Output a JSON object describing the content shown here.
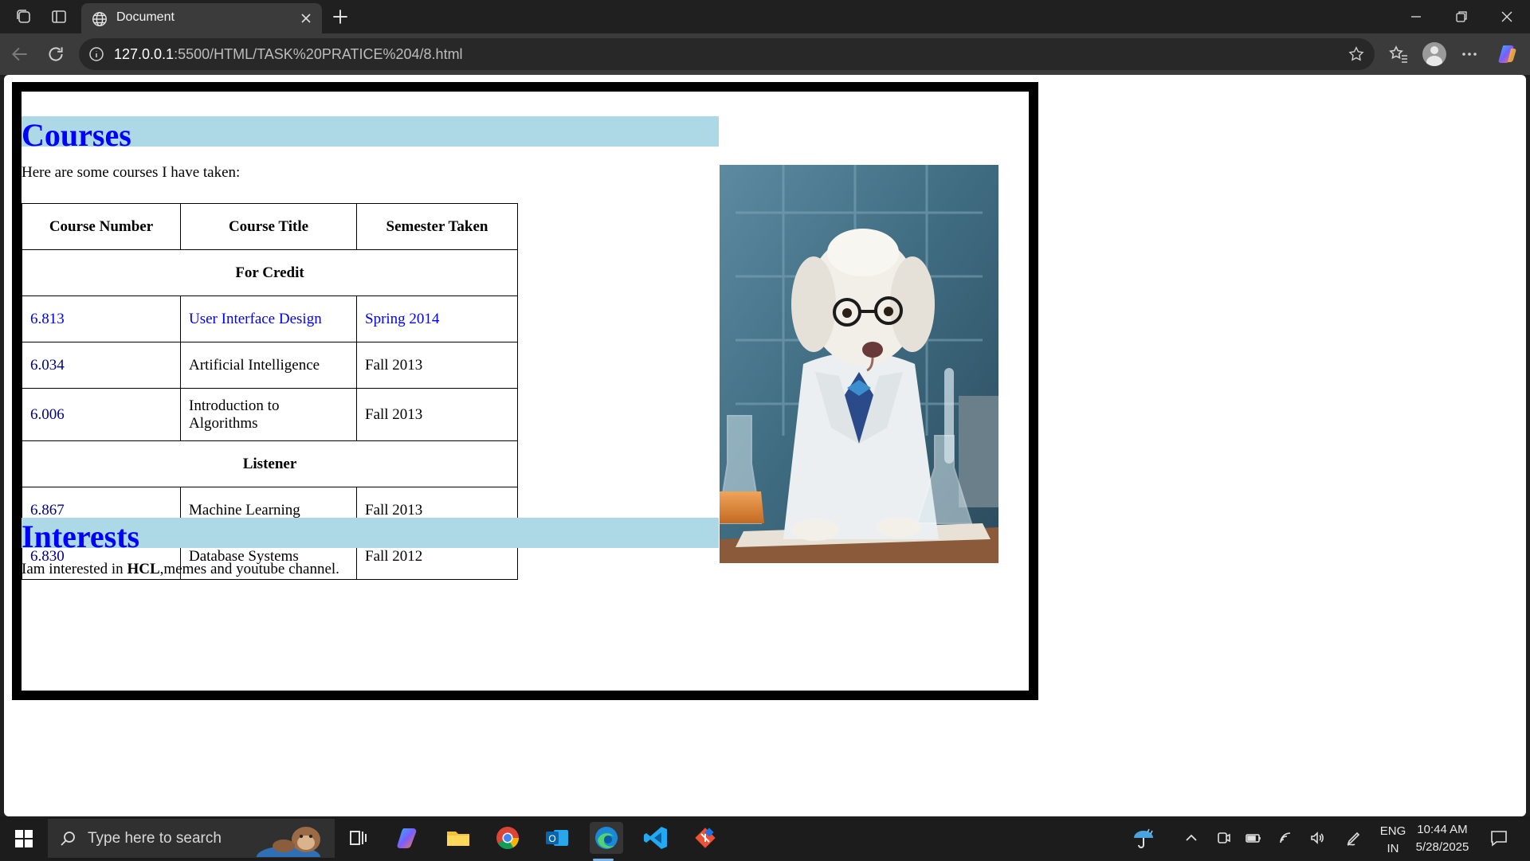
{
  "browser": {
    "tab_title": "Document",
    "url_host": "127.0.0.1",
    "url_rest": ":5500/HTML/TASK%20PRATICE%204/8.html"
  },
  "page": {
    "courses_heading": "Courses",
    "intro": "Here are some courses I have taken:",
    "table": {
      "headers": [
        "Course Number",
        "Course Title",
        "Semester Taken"
      ],
      "group1": "For Credit",
      "group1_rows": [
        {
          "number": "6.813",
          "title": "User Interface Design",
          "semester": "Spring 2014"
        },
        {
          "number": "6.034",
          "title": "Artificial Intelligence",
          "semester": "Fall 2013"
        },
        {
          "number": "6.006",
          "title": "Introduction to Algorithms",
          "semester": "Fall 2013"
        }
      ],
      "group2": "Listener",
      "group2_rows": [
        {
          "number": "6.867",
          "title": "Machine Learning",
          "semester": "Fall 2013"
        },
        {
          "number": "6.830",
          "title": "Database Systems",
          "semester": "Fall 2012"
        }
      ]
    },
    "interests_heading": "Interests",
    "interests_pre": "Iam interested in ",
    "interests_bold": "HCL",
    "interests_post": ",memes and youtube channel."
  },
  "taskbar": {
    "search_placeholder": "Type here to search",
    "lang_top": "ENG",
    "lang_bottom": "IN",
    "time": "10:44 AM",
    "date": "5/28/2025"
  },
  "colors": {
    "heading_text": "#0000ff",
    "heading_bg": "#add8e6",
    "course_number": "#00008b",
    "highlight_row": "#0000ff"
  },
  "icons": [
    "workspaces-icon",
    "tab-actions-icon",
    "globe-icon",
    "close-icon",
    "plus-icon",
    "minimize-icon",
    "restore-icon",
    "window-close-icon",
    "back-icon",
    "refresh-icon",
    "info-icon",
    "star-icon",
    "favorites-icon",
    "profile-icon",
    "more-icon",
    "copilot-icon",
    "windows-start-icon",
    "search-icon",
    "task-view-icon",
    "copilot-app-icon",
    "file-explorer-icon",
    "chrome-icon",
    "outlook-icon",
    "edge-icon",
    "vscode-icon",
    "git-icon",
    "weather-icon",
    "chevron-up-icon",
    "meet-icon",
    "battery-icon",
    "wifi-icon",
    "volume-icon",
    "pen-icon",
    "notification-icon"
  ]
}
